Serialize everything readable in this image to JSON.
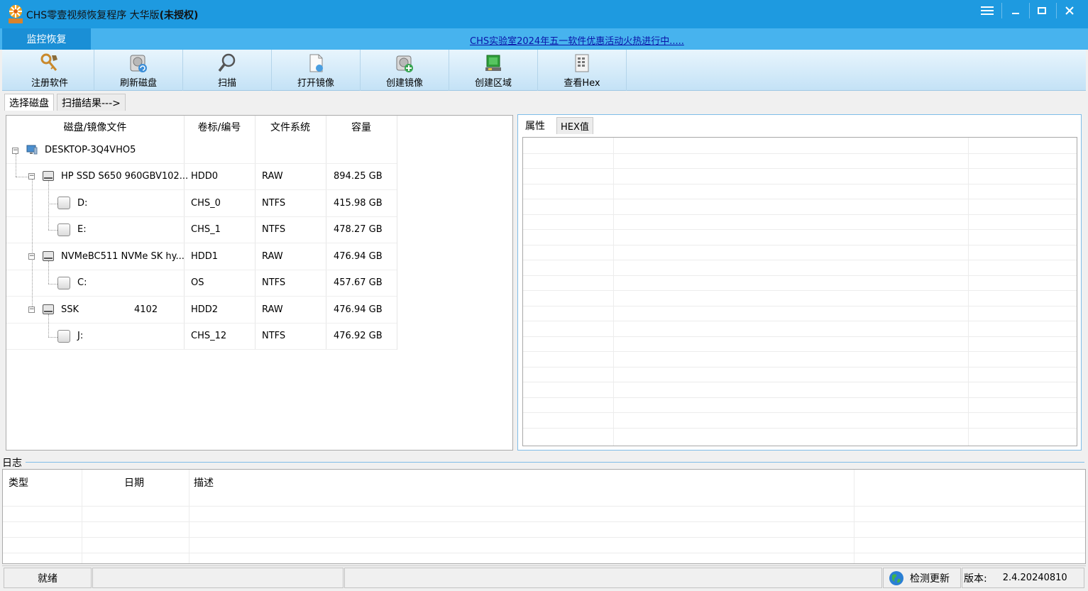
{
  "window": {
    "title_prefix": "CHS零壹视频恢复程序 大华版",
    "title_bold": "(未授权)",
    "controls": [
      "menu",
      "minimize",
      "maximize",
      "close"
    ]
  },
  "menu": {
    "active_tab": "监控恢复",
    "promo_link": "CHS实验室2024年五一软件优惠活动火热进行中....."
  },
  "toolbar": {
    "buttons": [
      {
        "label": "注册软件",
        "icon": "key-icon"
      },
      {
        "label": "刷新磁盘",
        "icon": "refresh-disk-icon"
      },
      {
        "label": "扫描",
        "icon": "magnifier-icon"
      },
      {
        "label": "打开镜像",
        "icon": "open-image-icon"
      },
      {
        "label": "创建镜像",
        "icon": "create-image-icon"
      },
      {
        "label": "创建区域",
        "icon": "create-region-icon"
      },
      {
        "label": "查看Hex",
        "icon": "hex-view-icon"
      }
    ]
  },
  "page_tabs": {
    "select_disk": "选择磁盘",
    "scan_results": "扫描结果--->"
  },
  "disk_table": {
    "headers": [
      "磁盘/镜像文件",
      "卷标/编号",
      "文件系统",
      "容量"
    ],
    "rows": [
      {
        "name": "DESKTOP-3Q4VHO5",
        "label": "",
        "fs": "",
        "size": ""
      },
      {
        "name": "HP SSD S650 960GBV102...",
        "label": "HDD0",
        "fs": "RAW",
        "size": "894.25 GB"
      },
      {
        "name": "D:",
        "label": "CHS_0",
        "fs": "NTFS",
        "size": "415.98 GB"
      },
      {
        "name": "E:",
        "label": "CHS_1",
        "fs": "NTFS",
        "size": "478.27 GB"
      },
      {
        "name": "NVMeBC511 NVMe SK hy...",
        "label": "HDD1",
        "fs": "RAW",
        "size": "476.94 GB"
      },
      {
        "name": "C:",
        "label": "OS",
        "fs": "NTFS",
        "size": "457.67 GB"
      },
      {
        "name": "SSK",
        "name_extra": "4102",
        "label": "HDD2",
        "fs": "RAW",
        "size": "476.94 GB"
      },
      {
        "name": "J:",
        "label": "CHS_12",
        "fs": "NTFS",
        "size": "476.92 GB"
      }
    ]
  },
  "right_tabs": {
    "properties": "属性",
    "hex": "HEX值"
  },
  "log": {
    "section_label": "日志",
    "headers": [
      "类型",
      "日期",
      "描述"
    ]
  },
  "status": {
    "ready": "就绪",
    "check_update": "检测更新",
    "version_label": "版本:",
    "version": "2.4.20240810"
  }
}
